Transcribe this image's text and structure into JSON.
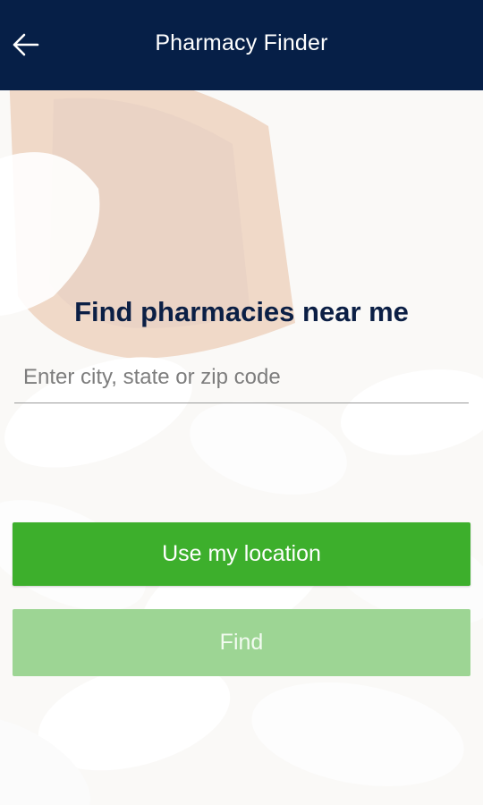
{
  "app_bar": {
    "title": "Pharmacy Finder",
    "back_icon": "arrow-left-icon",
    "background_color": "#061f47"
  },
  "main": {
    "heading": "Find pharmacies near me",
    "search": {
      "placeholder": "Enter city, state or zip code",
      "value": ""
    },
    "use_location_button": {
      "label": "Use my location",
      "color": "#3daf2c"
    },
    "find_button": {
      "label": "Find",
      "color": "#9dd594",
      "state": "disabled"
    }
  }
}
